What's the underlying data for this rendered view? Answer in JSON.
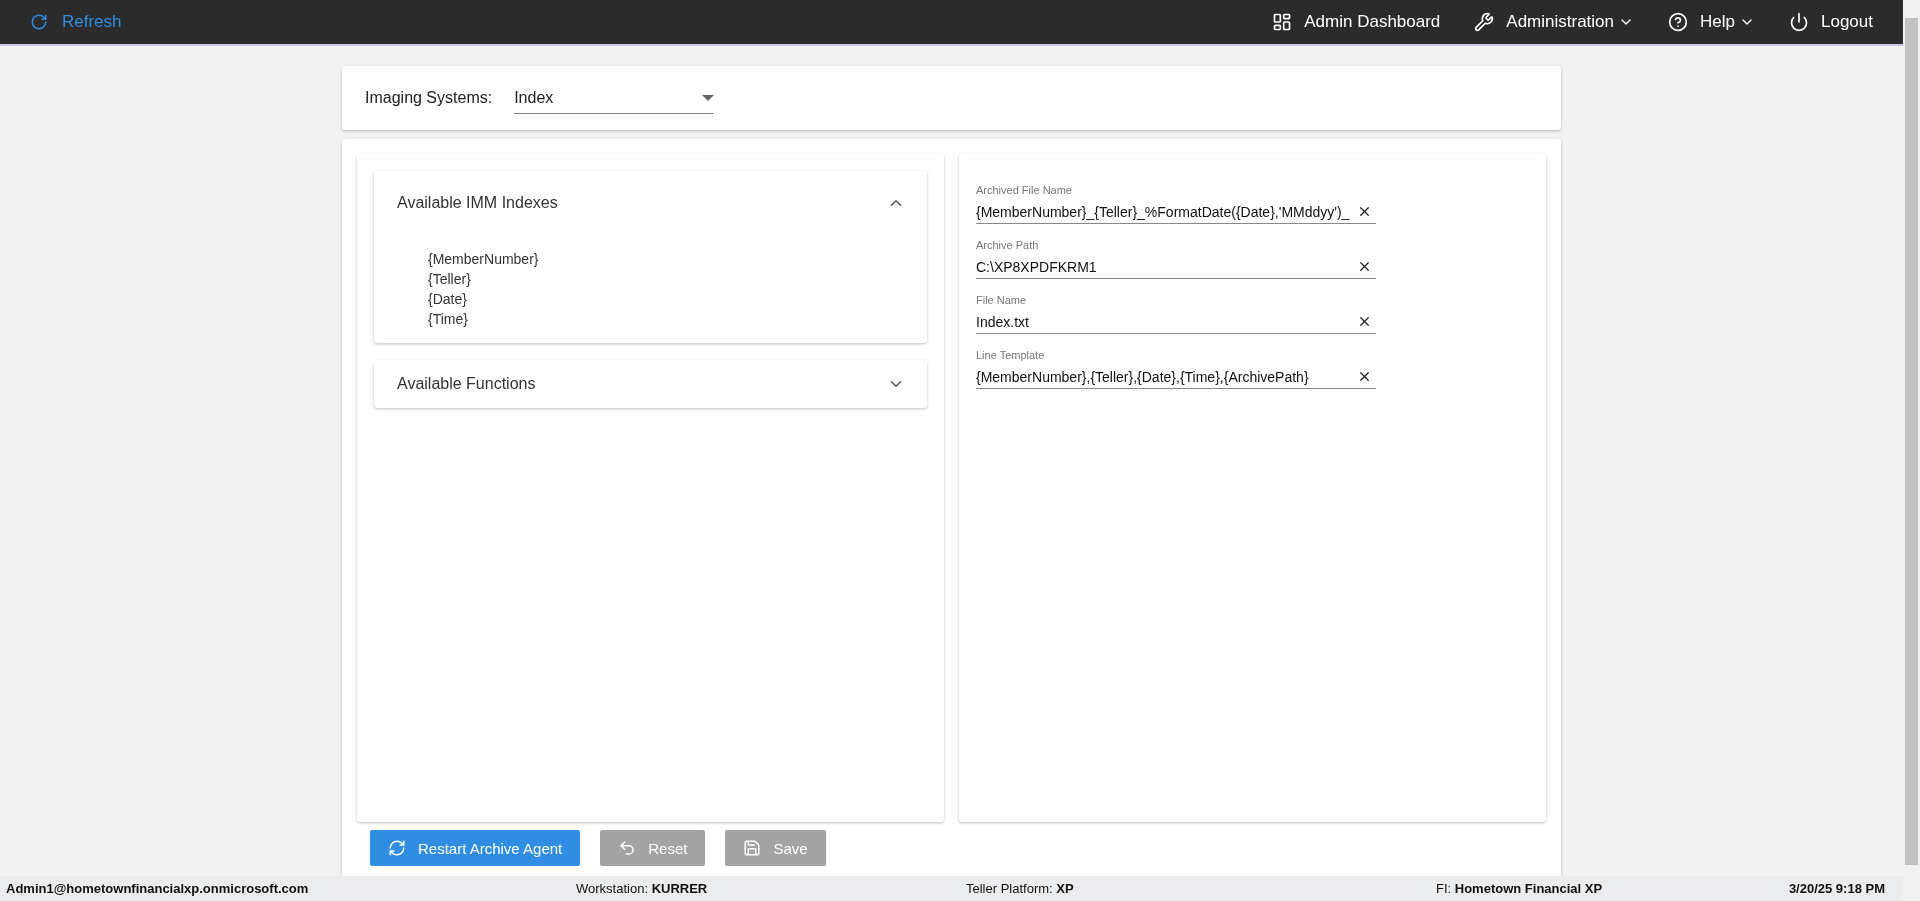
{
  "top_bar": {
    "refresh": "Refresh",
    "menu": [
      {
        "kind": "dashboard",
        "label": "Admin Dashboard",
        "dropdown": false
      },
      {
        "kind": "wrench",
        "label": "Administration",
        "dropdown": true
      },
      {
        "kind": "help",
        "label": "Help",
        "dropdown": true
      },
      {
        "kind": "power",
        "label": "Logout",
        "dropdown": false
      }
    ]
  },
  "imaging_systems": {
    "label": "Imaging Systems:",
    "value": "Index"
  },
  "accordions": [
    {
      "title": "Available IMM Indexes",
      "expanded": true,
      "items": [
        "{MemberNumber}",
        "{Teller}",
        "{Date}",
        "{Time}"
      ]
    },
    {
      "title": "Available Functions",
      "expanded": false
    }
  ],
  "fields": [
    {
      "label": "Archived File Name",
      "value": "{MemberNumber}_{Teller}_%FormatDate({Date},'MMddyy')_"
    },
    {
      "label": "Archive Path",
      "value": "C:\\XP8XPDFKRM1"
    },
    {
      "label": "File Name",
      "value": "Index.txt"
    },
    {
      "label": "Line Template",
      "value": "{MemberNumber},{Teller},{Date},{Time},{ArchivePath}"
    }
  ],
  "buttons": [
    {
      "kind": "restart",
      "label": "Restart Archive Agent",
      "disabled": false
    },
    {
      "kind": "reset",
      "label": "Reset",
      "disabled": true
    },
    {
      "kind": "save",
      "label": "Save",
      "disabled": true
    }
  ],
  "status_bar": {
    "user": "Admin1@hometownfinancialxp.onmicrosoft.com",
    "workstation": "Workstation: **KURRER**",
    "platform": "Teller Platform: **XP**",
    "fi": "FI: **Hometown Financial XP**",
    "datetime": "3/20/25 9:18 PM"
  }
}
